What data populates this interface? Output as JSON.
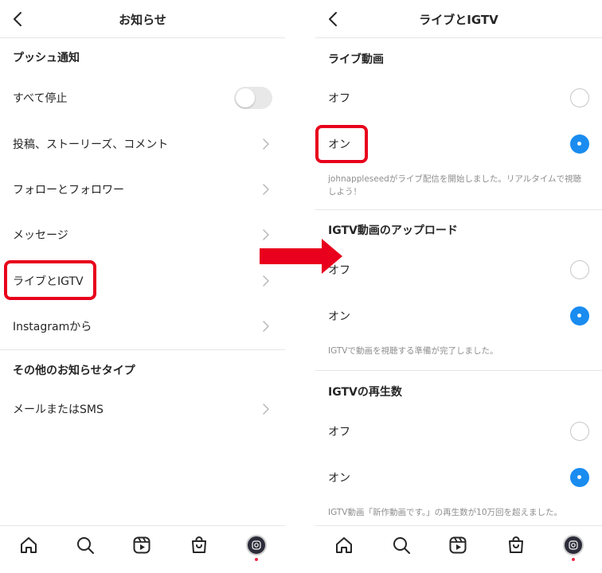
{
  "left": {
    "title": "お知らせ",
    "section_push": "プッシュ通知",
    "stop_all": "すべて停止",
    "items": [
      "投稿、ストーリーズ、コメント",
      "フォローとフォロワー",
      "メッセージ",
      "ライブとIGTV",
      "Instagramから"
    ],
    "section_other": "その他のお知らせタイプ",
    "email_sms": "メールまたはSMS"
  },
  "right": {
    "title": "ライブとIGTV",
    "live": {
      "section": "ライブ動画",
      "off": "オフ",
      "on": "オン",
      "desc": "johnappleseedがライブ配信を開始しました。リアルタイムで視聴しよう！"
    },
    "upload": {
      "section": "IGTV動画のアップロード",
      "off": "オフ",
      "on": "オン",
      "desc": "IGTVで動画を視聴する準備が完了しました。"
    },
    "views": {
      "section": "IGTVの再生数",
      "off": "オフ",
      "on": "オン",
      "desc": "IGTV動画「新作動画です。」の再生数が10万回を超えました。"
    }
  },
  "tabs": [
    "home-icon",
    "search-icon",
    "reels-icon",
    "shop-icon",
    "profile-avatar"
  ],
  "colors": {
    "accent_blue": "#1a8cf0",
    "highlight_red": "#e8001c",
    "divider": "#e6e6e6",
    "text": "#262626",
    "muted": "#8e8e8e"
  }
}
